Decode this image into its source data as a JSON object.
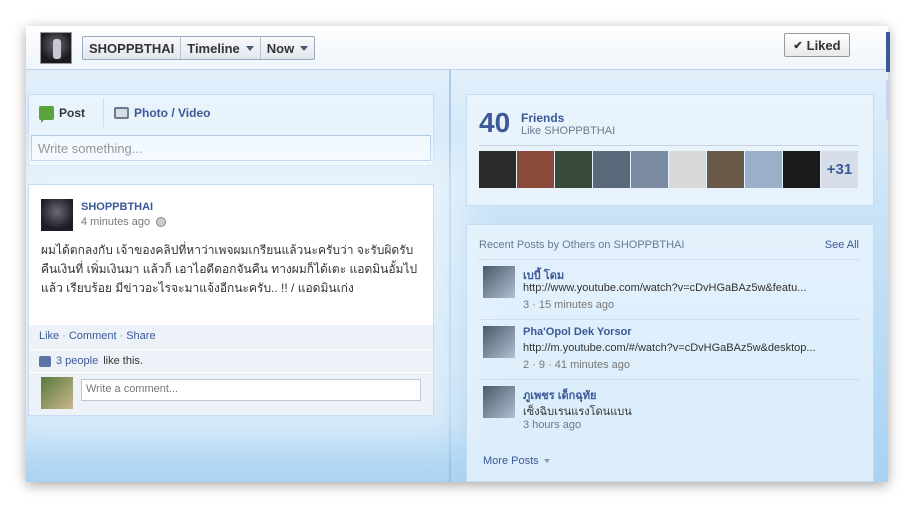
{
  "header": {
    "page_name": "SHOPPBTHAI",
    "timeline_label": "Timeline",
    "now_label": "Now",
    "liked_label": "Liked"
  },
  "composer": {
    "post_tab": "Post",
    "photo_tab": "Photo / Video",
    "placeholder": "Write something..."
  },
  "story": {
    "author": "SHOPPBTHAI",
    "time": "4 minutes ago",
    "text": "ผมได้ตกลงกับ เจ้าของคลิปที่หาว่าเพจผมเกรียนแล้วนะครับว่า จะรับผิดรับ คืนเงินที่ เพิ่มเงินมา แล้วก็ เอาไอดีดอกจันคืน ทางผมก็ได้เตะ แอดมินอั้มไป แล้ว เรียบร้อย มีข่าวอะไรจะมาแจ้งอีกนะครับ.. !! / แอดมินเก่ง",
    "like": "Like",
    "comment": "Comment",
    "share": "Share",
    "likes_link": "3 people",
    "likes_suffix": "like this.",
    "comment_placeholder": "Write a comment..."
  },
  "friends": {
    "count": "40",
    "title": "Friends",
    "subtitle": "Like SHOPPBTHAI",
    "more": "+31"
  },
  "recent": {
    "title": "Recent Posts by Others on SHOPPBTHAI",
    "see_all": "See All",
    "posts": [
      {
        "name": "เบบี้ โดม",
        "text": "http://www.youtube.com/watch?v=cDvHGaBAz5w&featu...",
        "meta": "3 · 15 minutes ago"
      },
      {
        "name": "Pha'Opol Dek Yorsor",
        "text": "http://m.youtube.com/#/watch?v=cDvHGaBAz5w&desktop...",
        "meta": "2 · 9 · 41 minutes ago"
      },
      {
        "name": "ภูเพชร เด็กฉุทัย",
        "text": "เซ็งฉิบเรนแรงโดนแบน",
        "meta": "3 hours ago"
      }
    ],
    "more_posts": "More Posts"
  }
}
